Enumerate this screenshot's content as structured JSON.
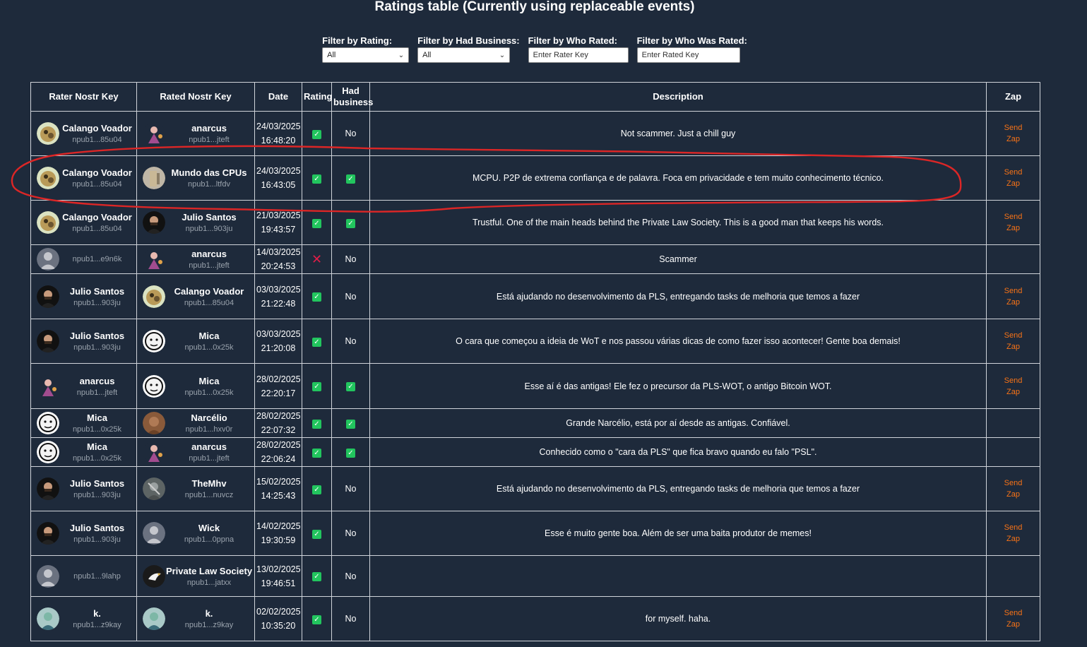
{
  "title": "Ratings table (Currently using replaceable events)",
  "filters": {
    "rating": {
      "label": "Filter by Rating:",
      "value": "All"
    },
    "business": {
      "label": "Filter by Had Business:",
      "value": "All"
    },
    "rater": {
      "label": "Filter by Who Rated:",
      "placeholder": "Enter Rater Key"
    },
    "rated": {
      "label": "Filter by Who Was Rated:",
      "placeholder": "Enter Rated Key"
    }
  },
  "columns": {
    "rater": "Rater Nostr Key",
    "rated": "Rated Nostr Key",
    "date": "Date",
    "rating": "Rating",
    "business": "Had business",
    "description": "Description",
    "zap": "Zap"
  },
  "zap": {
    "send": "Send",
    "zap": "Zap"
  },
  "no_label": "No",
  "colors": {
    "background": "#1e2a3b",
    "check": "#22c55e",
    "cross": "#e11d48",
    "zap": "#f97316",
    "annotation": "#dc2626"
  },
  "rows": [
    {
      "rater_name": "Calango Voador",
      "rater_key": "npub1...85u04",
      "rater_icon": "calango-avatar",
      "rated_name": "anarcus",
      "rated_key": "npub1...jteft",
      "rated_icon": "anarcus-avatar",
      "date": "24/03/2025",
      "time": "16:48:20",
      "rating": "positive",
      "business": "no",
      "description": "Not scammer. Just a chill guy",
      "zap": true
    },
    {
      "rater_name": "Calango Voador",
      "rater_key": "npub1...85u04",
      "rater_icon": "calango-avatar",
      "rated_name": "Mundo das CPUs",
      "rated_key": "npub1...ltfdv",
      "rated_icon": "cpu-avatar",
      "date": "24/03/2025",
      "time": "16:43:05",
      "rating": "positive",
      "business": "yes",
      "description": "MCPU. P2P de extrema confiança e de palavra. Foca em privacidade e tem muito conhecimento técnico.",
      "zap": true
    },
    {
      "rater_name": "Calango Voador",
      "rater_key": "npub1...85u04",
      "rater_icon": "calango-avatar",
      "rated_name": "Julio Santos",
      "rated_key": "npub1...903ju",
      "rated_icon": "julio-avatar",
      "date": "21/03/2025",
      "time": "19:43:57",
      "rating": "positive",
      "business": "yes",
      "description": "Trustful. One of the main heads behind the Private Law Society. This is a good man that keeps his words.",
      "zap": true
    },
    {
      "rater_name": "",
      "rater_key": "npub1...e9n6k",
      "rater_icon": "default-avatar",
      "rated_name": "anarcus",
      "rated_key": "npub1...jteft",
      "rated_icon": "anarcus-avatar",
      "date": "14/03/2025",
      "time": "20:24:53",
      "rating": "negative",
      "business": "no",
      "description": "Scammer",
      "zap": false
    },
    {
      "rater_name": "Julio Santos",
      "rater_key": "npub1...903ju",
      "rater_icon": "julio-avatar",
      "rated_name": "Calango Voador",
      "rated_key": "npub1...85u04",
      "rated_icon": "calango-avatar",
      "date": "03/03/2025",
      "time": "21:22:48",
      "rating": "positive",
      "business": "no",
      "description": "Está ajudando no desenvolvimento da PLS, entregando tasks de melhoria que temos a fazer",
      "zap": true
    },
    {
      "rater_name": "Julio Santos",
      "rater_key": "npub1...903ju",
      "rater_icon": "julio-avatar",
      "rated_name": "Mica",
      "rated_key": "npub1...0x25k",
      "rated_icon": "mica-avatar",
      "date": "03/03/2025",
      "time": "21:20:08",
      "rating": "positive",
      "business": "no",
      "description": "O cara que começou a ideia de WoT e nos passou várias dicas de como fazer isso acontecer! Gente boa demais!",
      "zap": true
    },
    {
      "rater_name": "anarcus",
      "rater_key": "npub1...jteft",
      "rater_icon": "anarcus-avatar",
      "rated_name": "Mica",
      "rated_key": "npub1...0x25k",
      "rated_icon": "mica-avatar",
      "date": "28/02/2025",
      "time": "22:20:17",
      "rating": "positive",
      "business": "yes",
      "description": "Esse aí é das antigas! Ele fez o precursor da PLS-WOT, o antigo Bitcoin WOT.",
      "zap": true
    },
    {
      "rater_name": "Mica",
      "rater_key": "npub1...0x25k",
      "rater_icon": "mica-avatar",
      "rated_name": "Narcélio",
      "rated_key": "npub1...hxv0r",
      "rated_icon": "narcelio-avatar",
      "date": "28/02/2025",
      "time": "22:07:32",
      "rating": "positive",
      "business": "yes",
      "description": "Grande Narcélio, está por aí desde as antigas. Confiável.",
      "zap": false
    },
    {
      "rater_name": "Mica",
      "rater_key": "npub1...0x25k",
      "rater_icon": "mica-avatar",
      "rated_name": "anarcus",
      "rated_key": "npub1...jteft",
      "rated_icon": "anarcus-avatar",
      "date": "28/02/2025",
      "time": "22:06:24",
      "rating": "positive",
      "business": "yes",
      "description": "Conhecido como o \"cara da PLS\" que fica bravo quando eu falo \"PSL\".",
      "zap": false
    },
    {
      "rater_name": "Julio Santos",
      "rater_key": "npub1...903ju",
      "rater_icon": "julio-avatar",
      "rated_name": "TheMhv",
      "rated_key": "npub1...nuvcz",
      "rated_icon": "themhv-avatar",
      "date": "15/02/2025",
      "time": "14:25:43",
      "rating": "positive",
      "business": "no",
      "description": "Está ajudando no desenvolvimento da PLS, entregando tasks de melhoria que temos a fazer",
      "zap": true
    },
    {
      "rater_name": "Julio Santos",
      "rater_key": "npub1...903ju",
      "rater_icon": "julio-avatar",
      "rated_name": "Wick",
      "rated_key": "npub1...0ppna",
      "rated_icon": "default-avatar",
      "date": "14/02/2025",
      "time": "19:30:59",
      "rating": "positive",
      "business": "no",
      "description": "Esse é muito gente boa. Além de ser uma baita produtor de memes!",
      "zap": true
    },
    {
      "rater_name": "",
      "rater_key": "npub1...9lahp",
      "rater_icon": "default-avatar",
      "rated_name": "Private Law Society",
      "rated_key": "npub1...jatxx",
      "rated_icon": "pls-eagle-avatar",
      "date": "13/02/2025",
      "time": "19:46:51",
      "rating": "positive",
      "business": "no",
      "description": "",
      "zap": false
    },
    {
      "rater_name": "k.",
      "rater_key": "npub1...z9kay",
      "rater_icon": "k-avatar",
      "rated_name": "k.",
      "rated_key": "npub1...z9kay",
      "rated_icon": "k-avatar",
      "date": "02/02/2025",
      "time": "10:35:20",
      "rating": "positive",
      "business": "no",
      "description": "for myself. haha.",
      "zap": true
    }
  ]
}
